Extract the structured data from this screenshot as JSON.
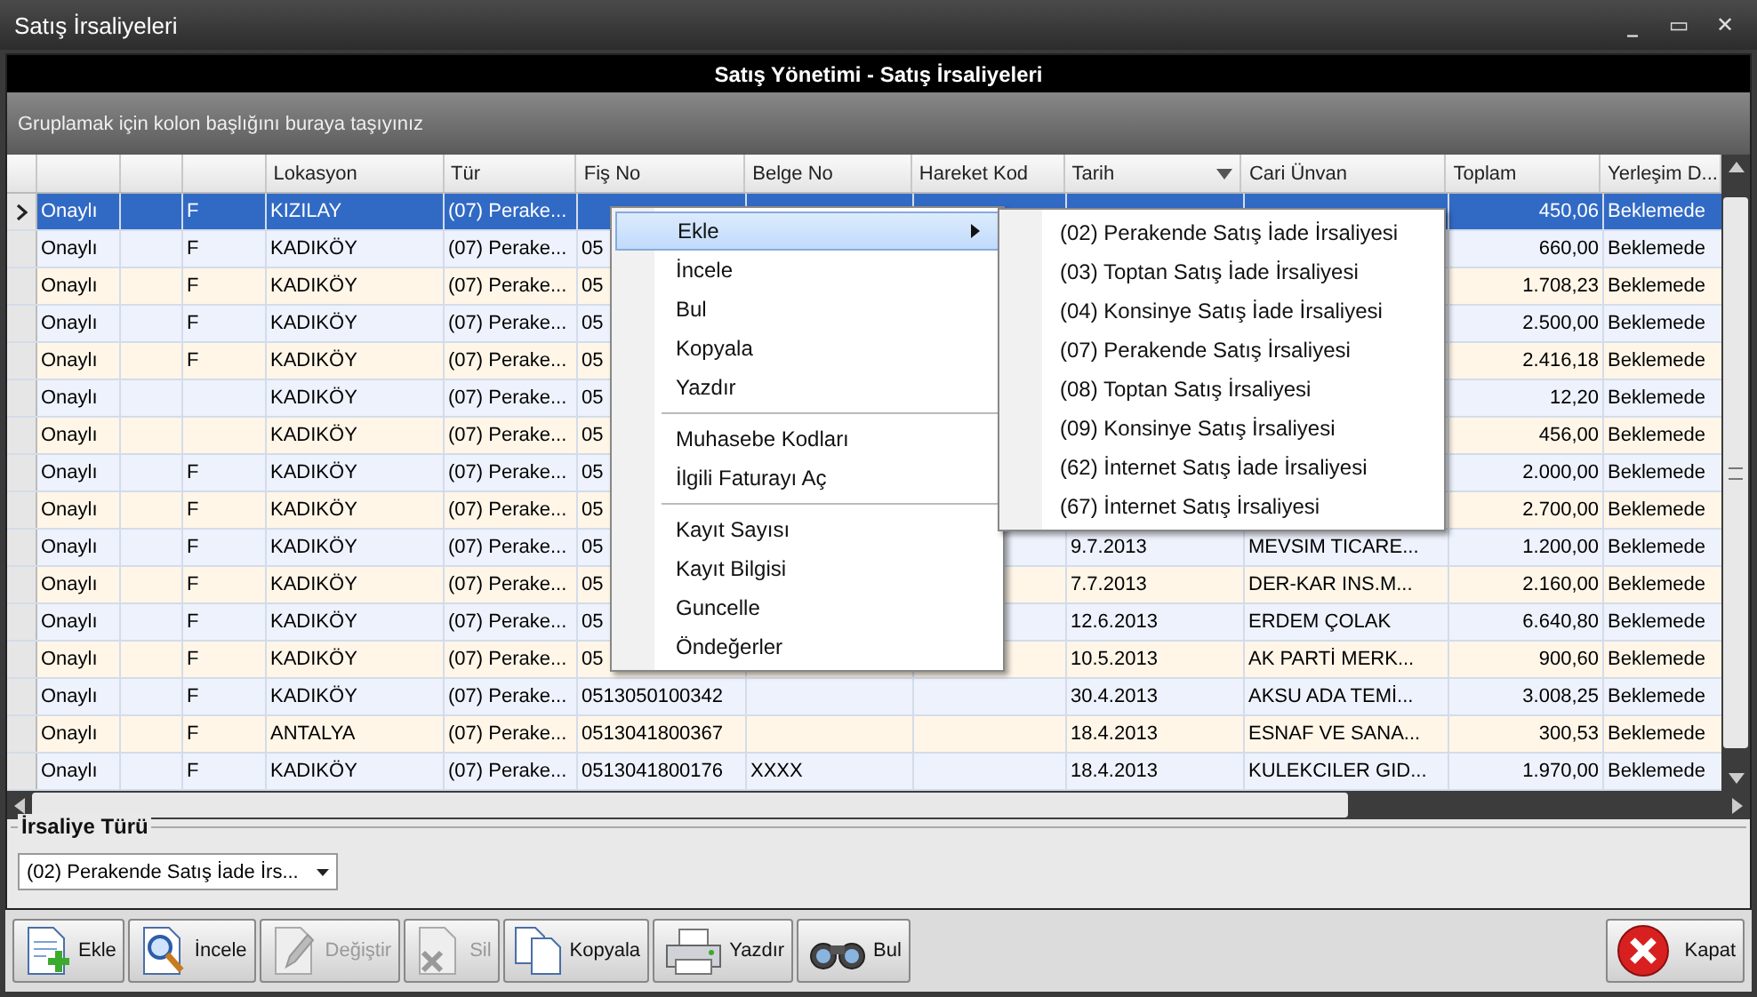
{
  "window": {
    "title": "Satış İrsaliyeleri",
    "controls": [
      "_",
      "▭",
      "✕"
    ]
  },
  "header": "Satış Yönetimi - Satış İrsaliyeleri",
  "group_panel": "Gruplamak için kolon başlığını buraya taşıyınız",
  "table": {
    "columns": [
      {},
      {},
      {},
      {
        "label": "Lokasyon"
      },
      {
        "label": "Tür"
      },
      {
        "label": "Fiş No"
      },
      {
        "label": "Belge No"
      },
      {
        "label": "Hareket Kod"
      },
      {
        "label": "Tarih",
        "sorted": true
      },
      {
        "label": "Cari Ünvan"
      },
      {
        "label": "Toplam"
      },
      {
        "label": "Yerleşim D..."
      }
    ],
    "rows": [
      {
        "selected": true,
        "cells": [
          "Onaylı",
          null,
          "F",
          "KIZILAY",
          "(07) Perake...",
          null,
          null,
          null,
          null,
          null,
          "450,06",
          "Beklemede"
        ]
      },
      {
        "selected": false,
        "cells": [
          "Onaylı",
          null,
          "F",
          "KADIKÖY",
          "(07) Perake...",
          "05",
          null,
          null,
          null,
          null,
          "660,00",
          "Beklemede"
        ]
      },
      {
        "selected": false,
        "cells": [
          "Onaylı",
          null,
          "F",
          "KADIKÖY",
          "(07) Perake...",
          "05",
          null,
          null,
          null,
          null,
          "1.708,23",
          "Beklemede"
        ]
      },
      {
        "selected": false,
        "cells": [
          "Onaylı",
          null,
          "F",
          "KADIKÖY",
          "(07) Perake...",
          "05",
          null,
          null,
          null,
          null,
          "2.500,00",
          "Beklemede"
        ]
      },
      {
        "selected": false,
        "cells": [
          "Onaylı",
          null,
          "F",
          "KADIKÖY",
          "(07) Perake...",
          "05",
          null,
          null,
          null,
          null,
          "2.416,18",
          "Beklemede"
        ]
      },
      {
        "selected": false,
        "cells": [
          "Onaylı",
          null,
          null,
          "KADIKÖY",
          "(07) Perake...",
          "05",
          null,
          null,
          null,
          null,
          "12,20",
          "Beklemede"
        ]
      },
      {
        "selected": false,
        "cells": [
          "Onaylı",
          null,
          null,
          "KADIKÖY",
          "(07) Perake...",
          "05",
          null,
          null,
          null,
          null,
          "456,00",
          "Beklemede"
        ]
      },
      {
        "selected": false,
        "cells": [
          "Onaylı",
          null,
          "F",
          "KADIKÖY",
          "(07) Perake...",
          "05",
          null,
          null,
          null,
          null,
          "2.000,00",
          "Beklemede"
        ]
      },
      {
        "selected": false,
        "cells": [
          "Onaylı",
          null,
          "F",
          "KADIKÖY",
          "(07) Perake...",
          "05",
          null,
          null,
          null,
          null,
          "2.700,00",
          "Beklemede"
        ]
      },
      {
        "selected": false,
        "cells": [
          "Onaylı",
          null,
          "F",
          "KADIKÖY",
          "(07) Perake...",
          "05",
          null,
          null,
          "9.7.2013",
          "MEVSIM TICARE...",
          "1.200,00",
          "Beklemede"
        ]
      },
      {
        "selected": false,
        "cells": [
          "Onaylı",
          null,
          "F",
          "KADIKÖY",
          "(07) Perake...",
          "05",
          null,
          null,
          "7.7.2013",
          "DER-KAR INS.M...",
          "2.160,00",
          "Beklemede"
        ]
      },
      {
        "selected": false,
        "cells": [
          "Onaylı",
          null,
          "F",
          "KADIKÖY",
          "(07) Perake...",
          "05",
          null,
          null,
          "12.6.2013",
          "ERDEM ÇOLAK",
          "6.640,80",
          "Beklemede"
        ]
      },
      {
        "selected": false,
        "cells": [
          "Onaylı",
          null,
          "F",
          "KADIKÖY",
          "(07) Perake...",
          "05",
          null,
          null,
          "10.5.2013",
          "AK PARTİ MERK...",
          "900,60",
          "Beklemede"
        ]
      },
      {
        "selected": false,
        "cells": [
          "Onaylı",
          null,
          "F",
          "KADIKÖY",
          "(07) Perake...",
          "0513050100342",
          null,
          null,
          "30.4.2013",
          "AKSU ADA TEMİ...",
          "3.008,25",
          "Beklemede"
        ]
      },
      {
        "selected": false,
        "cells": [
          "Onaylı",
          null,
          "F",
          "ANTALYA",
          "(07) Perake...",
          "0513041800367",
          null,
          null,
          "18.4.2013",
          "ESNAF VE SANA...",
          "300,53",
          "Beklemede"
        ]
      },
      {
        "selected": false,
        "cells": [
          "Onaylı",
          null,
          "F",
          "KADIKÖY",
          "(07) Perake...",
          "0513041800176",
          "XXXX",
          null,
          "18.4.2013",
          "KULEKCILER GID...",
          "1.970,00",
          "Beklemede"
        ]
      }
    ]
  },
  "context_menu": {
    "items": [
      {
        "kind": "item",
        "label": "Ekle",
        "selected": true,
        "submenu": true
      },
      {
        "kind": "item",
        "label": "İncele",
        "selected": false,
        "submenu": false
      },
      {
        "kind": "item",
        "label": "Bul",
        "selected": false,
        "submenu": false
      },
      {
        "kind": "item",
        "label": "Kopyala",
        "selected": false,
        "submenu": false
      },
      {
        "kind": "item",
        "label": "Yazdır",
        "selected": false,
        "submenu": false
      },
      {
        "kind": "separator"
      },
      {
        "kind": "item",
        "label": "Muhasebe Kodları",
        "selected": false,
        "submenu": false
      },
      {
        "kind": "item",
        "label": "İlgili Faturayı Aç",
        "selected": false,
        "submenu": false
      },
      {
        "kind": "separator"
      },
      {
        "kind": "item",
        "label": "Kayıt Sayısı",
        "selected": false,
        "submenu": false
      },
      {
        "kind": "item",
        "label": "Kayıt Bilgisi",
        "selected": false,
        "submenu": false
      },
      {
        "kind": "item",
        "label": "Guncelle",
        "selected": false,
        "submenu": false
      },
      {
        "kind": "item",
        "label": "Öndeğerler",
        "selected": false,
        "submenu": false
      }
    ]
  },
  "submenu": {
    "items": [
      "(02) Perakende Satış İade İrsaliyesi",
      "(03) Toptan Satış İade İrsaliyesi",
      "(04) Konsinye Satış İade İrsaliyesi",
      "(07) Perakende Satış İrsaliyesi",
      "(08) Toptan Satış İrsaliyesi",
      "(09) Konsinye Satış İrsaliyesi",
      "(62) İnternet Satış İade İrsaliyesi",
      "(67) İnternet Satış İrsaliyesi"
    ]
  },
  "filter": {
    "label": "İrsaliye Türü",
    "value": "(02) Perakende Satış İade İrs..."
  },
  "toolbar": [
    {
      "label": "Ekle",
      "kind": "add",
      "disabled": false
    },
    {
      "label": "İncele",
      "kind": "view",
      "disabled": false
    },
    {
      "label": "Değiştir",
      "kind": "edit",
      "disabled": true
    },
    {
      "label": "Sil",
      "kind": "delete",
      "disabled": true
    },
    {
      "label": "Kopyala",
      "kind": "copy",
      "disabled": false
    },
    {
      "label": "Yazdır",
      "kind": "print",
      "disabled": false
    },
    {
      "label": "Bul",
      "kind": "find",
      "disabled": false
    },
    {
      "label": "Kapat",
      "kind": "close",
      "disabled": false
    }
  ]
}
